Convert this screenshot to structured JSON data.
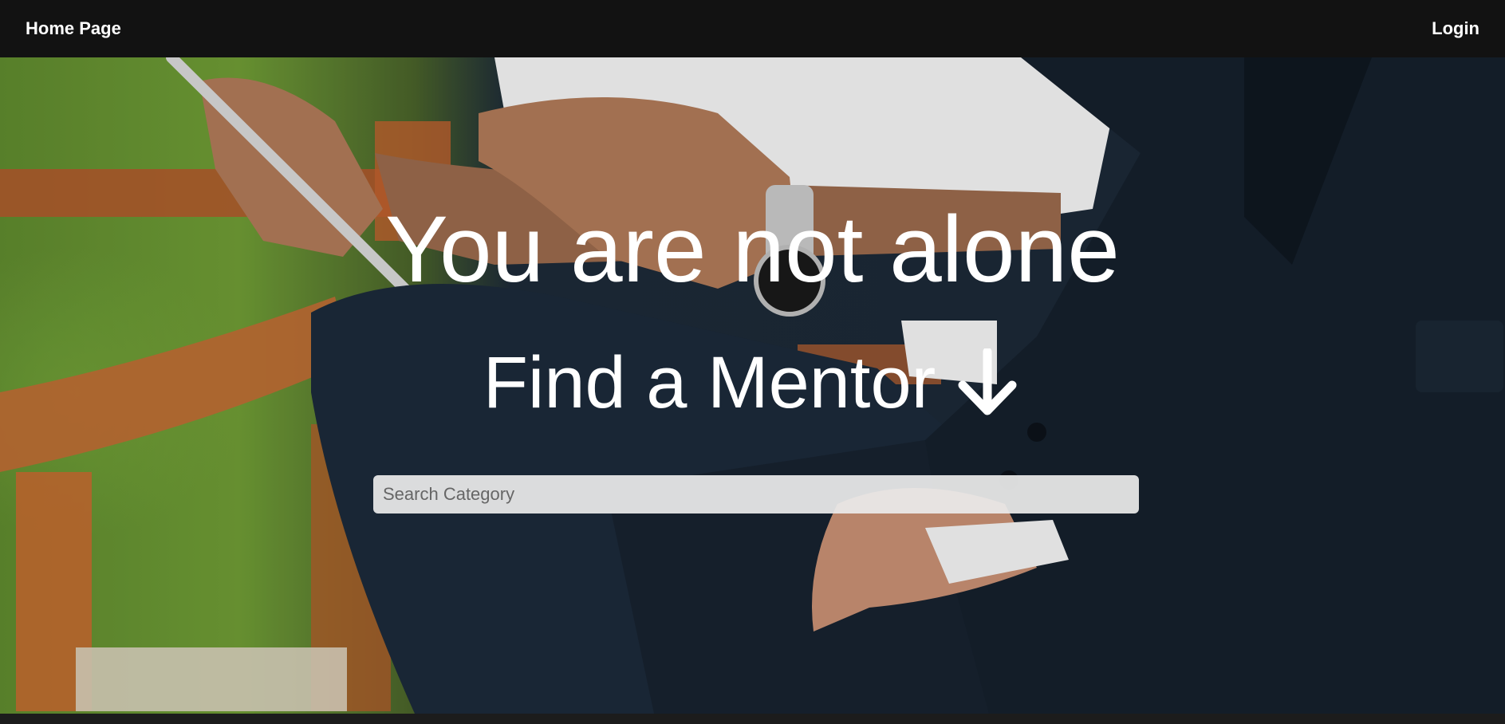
{
  "nav": {
    "home_label": "Home Page",
    "login_label": "Login"
  },
  "hero": {
    "headline": "You are not alone",
    "subheadline": "Find a Mentor",
    "arrow_icon": "arrow-down-icon",
    "background_image": "photo of two men in suits sitting on a wooden bench, one holding a tablet"
  },
  "search": {
    "placeholder": "Search Category",
    "value": ""
  },
  "colors": {
    "navbar_bg": "#121212",
    "text": "#ffffff",
    "search_bg": "#ebebeb"
  }
}
